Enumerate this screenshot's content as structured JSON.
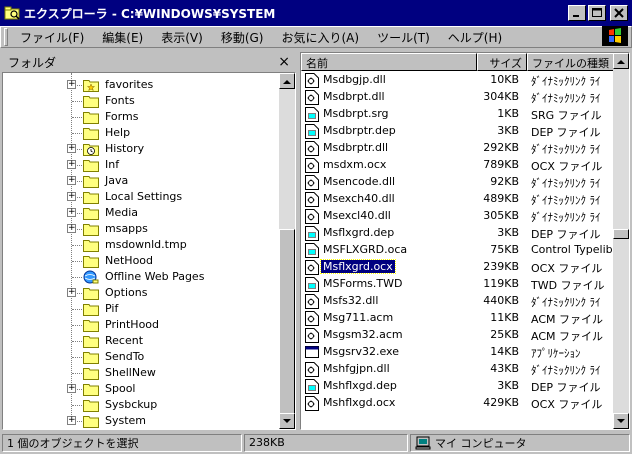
{
  "window": {
    "title": "エクスプローラ - C:¥WINDOWS¥SYSTEM",
    "minimize_icon": "minimize-icon",
    "maximize_icon": "maximize-icon",
    "close_icon": "close-icon"
  },
  "menu": {
    "items": [
      {
        "label": "ファイル(F)"
      },
      {
        "label": "編集(E)"
      },
      {
        "label": "表示(V)"
      },
      {
        "label": "移動(G)"
      },
      {
        "label": "お気に入り(A)"
      },
      {
        "label": "ツール(T)"
      },
      {
        "label": "ヘルプ(H)"
      }
    ]
  },
  "folder_pane": {
    "title": "フォルダ",
    "close_glyph": "×",
    "items": [
      {
        "label": "favorites",
        "expander": "+",
        "icon": "favorites-folder"
      },
      {
        "label": "Fonts",
        "expander": "",
        "icon": "folder"
      },
      {
        "label": "Forms",
        "expander": "",
        "icon": "folder"
      },
      {
        "label": "Help",
        "expander": "",
        "icon": "folder"
      },
      {
        "label": "History",
        "expander": "+",
        "icon": "history-folder"
      },
      {
        "label": "Inf",
        "expander": "+",
        "icon": "folder"
      },
      {
        "label": "Java",
        "expander": "+",
        "icon": "folder"
      },
      {
        "label": "Local Settings",
        "expander": "+",
        "icon": "folder"
      },
      {
        "label": "Media",
        "expander": "+",
        "icon": "folder"
      },
      {
        "label": "msapps",
        "expander": "+",
        "icon": "folder"
      },
      {
        "label": "msdownld.tmp",
        "expander": "",
        "icon": "folder"
      },
      {
        "label": "NetHood",
        "expander": "",
        "icon": "folder"
      },
      {
        "label": "Offline Web Pages",
        "expander": "",
        "icon": "offline-folder"
      },
      {
        "label": "Options",
        "expander": "+",
        "icon": "folder"
      },
      {
        "label": "Pif",
        "expander": "",
        "icon": "folder"
      },
      {
        "label": "PrintHood",
        "expander": "",
        "icon": "folder"
      },
      {
        "label": "Recent",
        "expander": "",
        "icon": "folder"
      },
      {
        "label": "SendTo",
        "expander": "",
        "icon": "folder"
      },
      {
        "label": "ShellNew",
        "expander": "",
        "icon": "folder"
      },
      {
        "label": "Spool",
        "expander": "+",
        "icon": "folder"
      },
      {
        "label": "Sysbckup",
        "expander": "",
        "icon": "folder"
      },
      {
        "label": "System",
        "expander": "+",
        "icon": "folder"
      }
    ]
  },
  "file_pane": {
    "columns": {
      "name": "名前",
      "size": "サイズ",
      "type": "ファイルの種類"
    },
    "rows": [
      {
        "name": "Msdbgjp.dll",
        "size": "10KB",
        "type": "ﾀﾞｲﾅﾐｯｸﾘﾝｸ ﾗｲ",
        "icon": "dll"
      },
      {
        "name": "Msdbrpt.dll",
        "size": "304KB",
        "type": "ﾀﾞｲﾅﾐｯｸﾘﾝｸ ﾗｲ",
        "icon": "dll"
      },
      {
        "name": "Msdbrpt.srg",
        "size": "1KB",
        "type": "SRG ファイル",
        "icon": "file"
      },
      {
        "name": "Msdbrptr.dep",
        "size": "3KB",
        "type": "DEP ファイル",
        "icon": "file"
      },
      {
        "name": "Msdbrptr.dll",
        "size": "292KB",
        "type": "ﾀﾞｲﾅﾐｯｸﾘﾝｸ ﾗｲ",
        "icon": "dll"
      },
      {
        "name": "msdxm.ocx",
        "size": "789KB",
        "type": "OCX ファイル",
        "icon": "dll"
      },
      {
        "name": "Msencode.dll",
        "size": "92KB",
        "type": "ﾀﾞｲﾅﾐｯｸﾘﾝｸ ﾗｲ",
        "icon": "dll"
      },
      {
        "name": "Msexch40.dll",
        "size": "489KB",
        "type": "ﾀﾞｲﾅﾐｯｸﾘﾝｸ ﾗｲ",
        "icon": "dll"
      },
      {
        "name": "Msexcl40.dll",
        "size": "305KB",
        "type": "ﾀﾞｲﾅﾐｯｸﾘﾝｸ ﾗｲ",
        "icon": "dll"
      },
      {
        "name": "Msflxgrd.dep",
        "size": "3KB",
        "type": "DEP ファイル",
        "icon": "file"
      },
      {
        "name": "MSFLXGRD.oca",
        "size": "75KB",
        "type": "Control Typelib",
        "icon": "file"
      },
      {
        "name": "Msflxgrd.ocx",
        "size": "239KB",
        "type": "OCX ファイル",
        "icon": "dll",
        "selected": true
      },
      {
        "name": "MSForms.TWD",
        "size": "119KB",
        "type": "TWD ファイル",
        "icon": "file"
      },
      {
        "name": "Msfs32.dll",
        "size": "440KB",
        "type": "ﾀﾞｲﾅﾐｯｸﾘﾝｸ ﾗｲ",
        "icon": "dll"
      },
      {
        "name": "Msg711.acm",
        "size": "11KB",
        "type": "ACM ファイル",
        "icon": "dll"
      },
      {
        "name": "Msgsm32.acm",
        "size": "25KB",
        "type": "ACM ファイル",
        "icon": "dll"
      },
      {
        "name": "Msgsrv32.exe",
        "size": "14KB",
        "type": "ｱﾌﾟﾘｹｰｼｮﾝ",
        "icon": "exe"
      },
      {
        "name": "Mshfgjpn.dll",
        "size": "43KB",
        "type": "ﾀﾞｲﾅﾐｯｸﾘﾝｸ ﾗｲ",
        "icon": "dll"
      },
      {
        "name": "Mshflxgd.dep",
        "size": "3KB",
        "type": "DEP ファイル",
        "icon": "file"
      },
      {
        "name": "Mshflxgd.ocx",
        "size": "429KB",
        "type": "OCX ファイル",
        "icon": "dll"
      }
    ]
  },
  "status": {
    "selection": "1 個のオブジェクトを選択",
    "size": "238KB",
    "location": "マイ コンピュータ"
  },
  "colors": {
    "titlebar": "#000080",
    "selection": "#000080",
    "face": "#c0c0c0",
    "folder": "#ffff80"
  }
}
